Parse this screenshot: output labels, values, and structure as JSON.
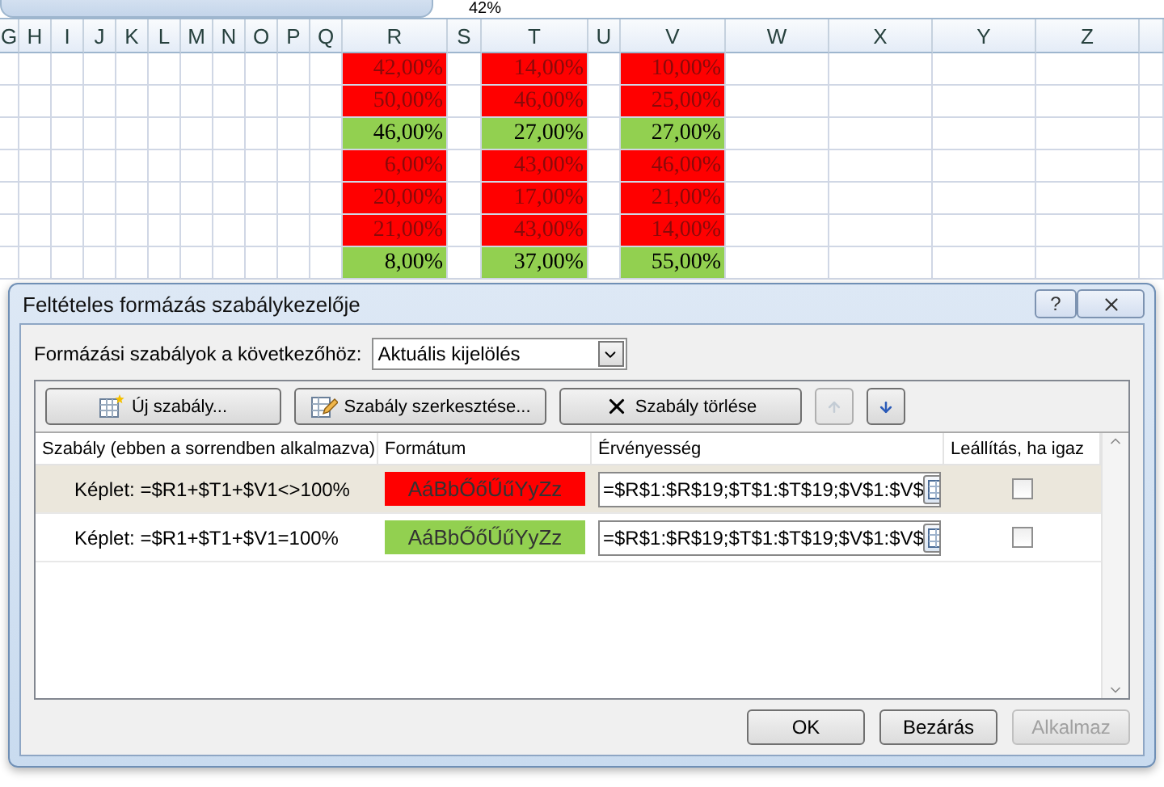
{
  "formula_bar": {
    "value": "42%"
  },
  "sheet": {
    "columns": [
      "G",
      "H",
      "I",
      "J",
      "K",
      "L",
      "M",
      "N",
      "O",
      "P",
      "Q",
      "R",
      "S",
      "T",
      "U",
      "V",
      "W",
      "X",
      "Y",
      "Z"
    ],
    "rows": [
      {
        "cells": [
          {
            "text": "42,00%",
            "color": "#ff0000"
          },
          {
            "text": "14,00%",
            "color": "#ff0000"
          },
          {
            "text": "10,00%",
            "color": "#ff0000"
          }
        ]
      },
      {
        "cells": [
          {
            "text": "50,00%",
            "color": "#ff0000"
          },
          {
            "text": "46,00%",
            "color": "#ff0000"
          },
          {
            "text": "25,00%",
            "color": "#ff0000"
          }
        ]
      },
      {
        "cells": [
          {
            "text": "46,00%",
            "color": "#92d050"
          },
          {
            "text": "27,00%",
            "color": "#92d050"
          },
          {
            "text": "27,00%",
            "color": "#92d050"
          }
        ]
      },
      {
        "cells": [
          {
            "text": "6,00%",
            "color": "#ff0000"
          },
          {
            "text": "43,00%",
            "color": "#ff0000"
          },
          {
            "text": "46,00%",
            "color": "#ff0000"
          }
        ]
      },
      {
        "cells": [
          {
            "text": "20,00%",
            "color": "#ff0000"
          },
          {
            "text": "17,00%",
            "color": "#ff0000"
          },
          {
            "text": "21,00%",
            "color": "#ff0000"
          }
        ]
      },
      {
        "cells": [
          {
            "text": "21,00%",
            "color": "#ff0000"
          },
          {
            "text": "43,00%",
            "color": "#ff0000"
          },
          {
            "text": "14,00%",
            "color": "#ff0000"
          }
        ]
      },
      {
        "cells": [
          {
            "text": "8,00%",
            "color": "#92d050"
          },
          {
            "text": "37,00%",
            "color": "#92d050"
          },
          {
            "text": "55,00%",
            "color": "#92d050"
          }
        ]
      }
    ]
  },
  "dialog": {
    "title": "Feltételes formázás szabálykezelője",
    "help": "?",
    "scope_label": "Formázási szabályok a következőhöz:",
    "scope_value": "Aktuális kijelölés",
    "toolbar": [
      {
        "kind": "new",
        "label": "Új szabály..."
      },
      {
        "kind": "edit",
        "label": "Szabály szerkesztése..."
      },
      {
        "kind": "delete",
        "label": "Szabály törlése"
      },
      {
        "kind": "up",
        "disabled": true
      },
      {
        "kind": "down",
        "disabled": false
      }
    ],
    "columns": [
      "Szabály (ebben a sorrendben alkalmazva)",
      "Formátum",
      "Érvényesség",
      "Leállítás, ha igaz"
    ],
    "rules": [
      {
        "rule": "Képlet: =$R1+$T1+$V1<>100%",
        "preview": "AáBbŐőŰűYyZz",
        "color": "#ff0000",
        "applies_to": "=$R$1:$R$19;$T$1:$T$19;$V$1:$V$",
        "stop": false,
        "selected": true
      },
      {
        "rule": "Képlet: =$R1+$T1+$V1=100%",
        "preview": "AáBbŐőŰűYyZz",
        "color": "#92d050",
        "applies_to": "=$R$1:$R$19;$T$1:$T$19;$V$1:$V$",
        "stop": false,
        "selected": false
      }
    ],
    "buttons": [
      {
        "label": "OK",
        "disabled": false
      },
      {
        "label": "Bezárás",
        "disabled": false
      },
      {
        "label": "Alkalmaz",
        "disabled": true
      }
    ]
  }
}
